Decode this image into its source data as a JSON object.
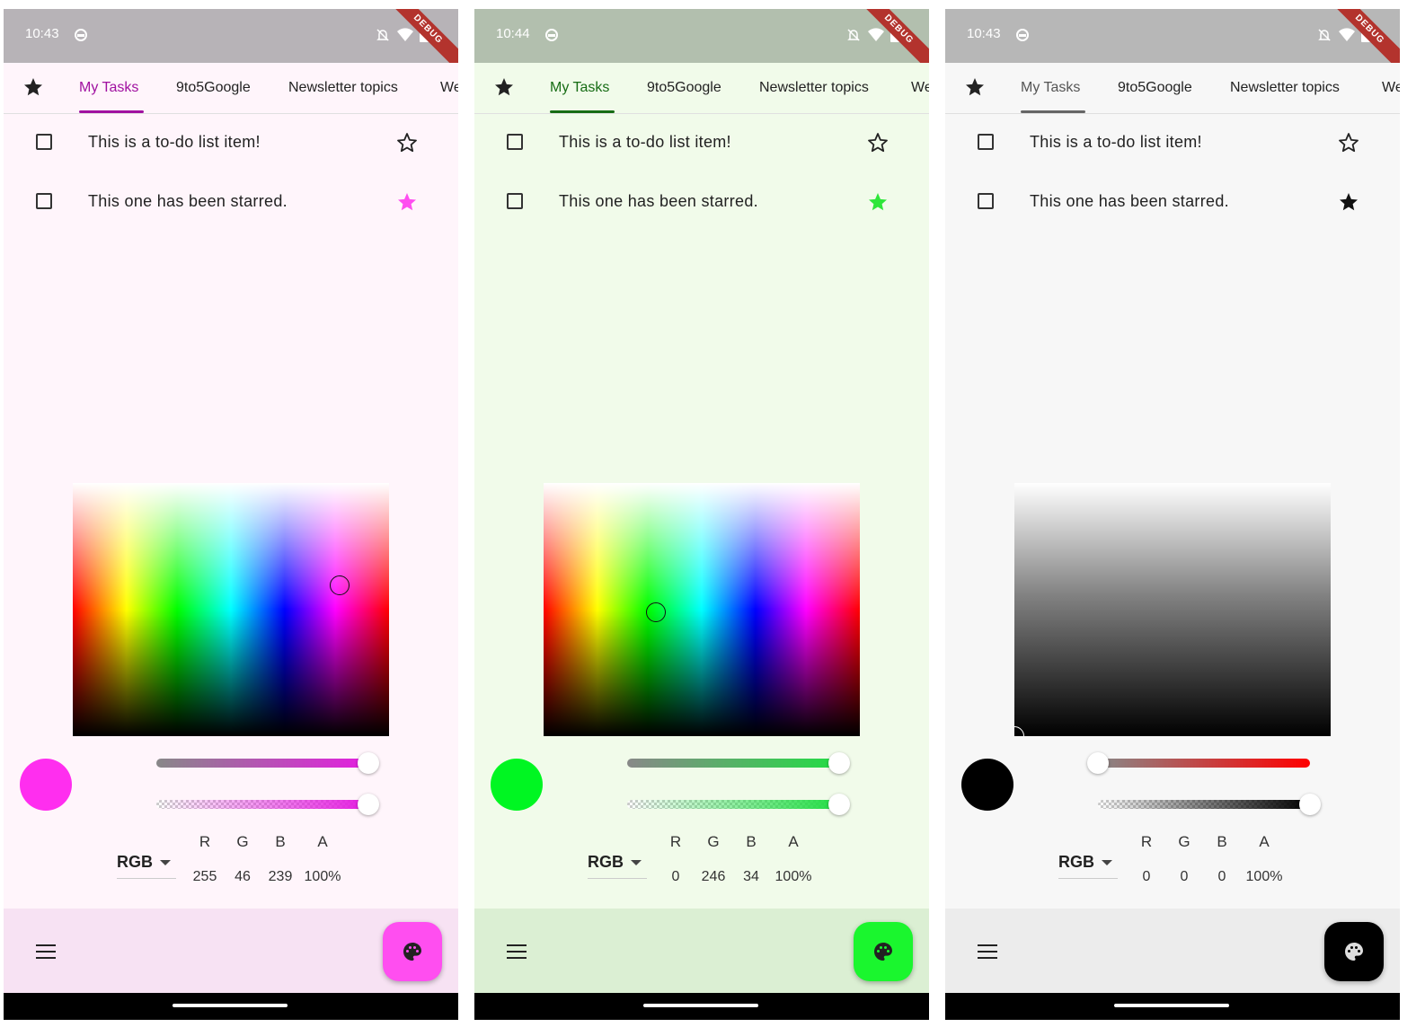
{
  "screens": [
    {
      "status": {
        "time": "10:43",
        "debug": "DEBUG"
      },
      "tabs": [
        "My Tasks",
        "9to5Google",
        "Newsletter topics",
        "We"
      ],
      "items": [
        {
          "text": "This is a to-do list item!",
          "starred": false
        },
        {
          "text": "This one has been starred.",
          "starred": true
        }
      ],
      "mode": "RGB",
      "channels": [
        "R",
        "G",
        "B",
        "A"
      ],
      "values": [
        "255",
        "46",
        "239",
        "100%"
      ],
      "colors": {
        "primary": "#ff2eef",
        "status_bg": "#b7b3b7",
        "surface": "#fff5fb",
        "bottom": "#f7e2f3",
        "fab": "#ff4ef0",
        "tab_text": "#a011a0",
        "indicator": "#a011a0",
        "star": "#ff4ef0",
        "slider1": "#e41ee0"
      },
      "hue_slider": 1.0,
      "alpha_slider": 1.0
    },
    {
      "status": {
        "time": "10:44",
        "debug": "DEBUG"
      },
      "tabs": [
        "My Tasks",
        "9to5Google",
        "Newsletter topics",
        "We"
      ],
      "items": [
        {
          "text": "This is a to-do list item!",
          "starred": false
        },
        {
          "text": "This one has been starred.",
          "starred": true
        }
      ],
      "mode": "RGB",
      "channels": [
        "R",
        "G",
        "B",
        "A"
      ],
      "values": [
        "0",
        "246",
        "34",
        "100%"
      ],
      "colors": {
        "primary": "#00f622",
        "status_bg": "#b2bfae",
        "surface": "#f1fbea",
        "bottom": "#dbefd3",
        "fab": "#1af62e",
        "tab_text": "#166c14",
        "indicator": "#166c14",
        "star": "#2ee63a",
        "slider1": "#22dd44"
      },
      "hue_slider": 1.0,
      "alpha_slider": 1.0
    },
    {
      "status": {
        "time": "10:43",
        "debug": "DEBUG"
      },
      "tabs": [
        "My Tasks",
        "9to5Google",
        "Newsletter topics",
        "We"
      ],
      "items": [
        {
          "text": "This is a to-do list item!",
          "starred": false
        },
        {
          "text": "This one has been starred.",
          "starred": true
        }
      ],
      "mode": "RGB",
      "channels": [
        "R",
        "G",
        "B",
        "A"
      ],
      "values": [
        "0",
        "0",
        "0",
        "100%"
      ],
      "colors": {
        "primary": "#000000",
        "status_bg": "#b7b7b7",
        "surface": "#f7f7f7",
        "bottom": "#ececec",
        "fab": "#000000",
        "tab_text": "#555555",
        "indicator": "#666666",
        "star": "#111111",
        "slider1": "#ff0000"
      },
      "hue_slider": 0.0,
      "alpha_slider": 1.0
    }
  ]
}
